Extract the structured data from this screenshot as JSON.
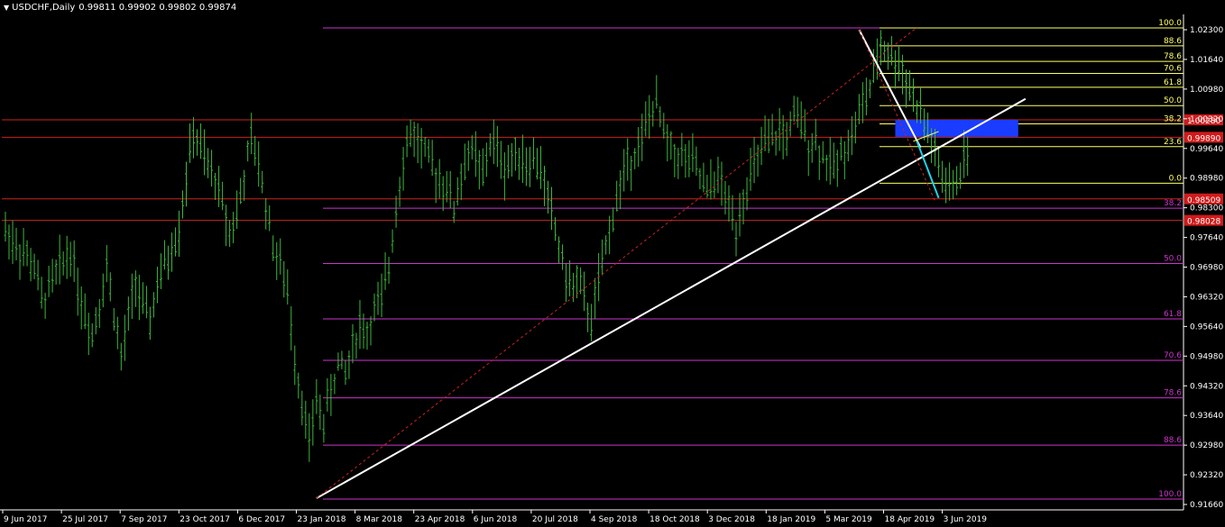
{
  "header": {
    "symbol": "USDCHF,Daily",
    "prices": "0.99811 0.99902 0.99802 0.99874"
  },
  "colors": {
    "background": "#000000",
    "candles": "#3cb83c",
    "fib_high": "#ffff66",
    "fib_low": "#cc33cc",
    "hline": "#cc2222",
    "trendline": "#ffffff",
    "dashed": "#cc2222",
    "projection": "#22d3e8",
    "zone": "#1a3cff",
    "price_tag": "#d11a1a",
    "axis_text": "#ffffff"
  },
  "chart_data": {
    "type": "candlestick",
    "title": "USDCHF,Daily",
    "ohlc_last": {
      "open": 0.99811,
      "high": 0.99902,
      "low": 0.99802,
      "close": 0.99874
    },
    "ylim": [
      0.914,
      1.0265
    ],
    "y_ticks": [
      "1.02300",
      "1.01640",
      "1.00980",
      "1.00320",
      "0.99640",
      "0.98980",
      "0.98300",
      "0.97640",
      "0.96980",
      "0.96320",
      "0.95640",
      "0.94980",
      "0.94320",
      "0.93640",
      "0.92980",
      "0.92320",
      "0.91660"
    ],
    "x_ticks": [
      "9 Jun 2017",
      "25 Jul 2017",
      "7 Sep 2017",
      "23 Oct 2017",
      "6 Dec 2017",
      "23 Jan 2018",
      "8 Mar 2018",
      "23 Apr 2018",
      "6 Jun 2018",
      "20 Jul 2018",
      "4 Sep 2018",
      "18 Oct 2018",
      "3 Dec 2018",
      "18 Jan 2019",
      "5 Mar 2019",
      "18 Apr 2019",
      "3 Jun 2019"
    ],
    "price_path": [
      [
        0,
        0.978
      ],
      [
        4,
        0.974
      ],
      [
        8,
        0.97
      ],
      [
        10,
        0.962
      ],
      [
        14,
        0.968
      ],
      [
        18,
        0.974
      ],
      [
        21,
        0.962
      ],
      [
        24,
        0.955
      ],
      [
        26,
        0.962
      ],
      [
        28,
        0.97
      ],
      [
        30,
        0.96
      ],
      [
        32,
        0.949
      ],
      [
        34,
        0.958
      ],
      [
        36,
        0.967
      ],
      [
        38,
        0.96
      ],
      [
        40,
        0.958
      ],
      [
        42,
        0.966
      ],
      [
        45,
        0.972
      ],
      [
        48,
        0.979
      ],
      [
        50,
        0.99
      ],
      [
        52,
        1.0
      ],
      [
        54,
        0.996
      ],
      [
        56,
        0.992
      ],
      [
        58,
        0.99
      ],
      [
        60,
        0.984
      ],
      [
        62,
        0.978
      ],
      [
        64,
        0.982
      ],
      [
        66,
        0.99
      ],
      [
        68,
        0.998
      ],
      [
        70,
        0.993
      ],
      [
        72,
        0.984
      ],
      [
        74,
        0.975
      ],
      [
        76,
        0.97
      ],
      [
        78,
        0.964
      ],
      [
        80,
        0.95
      ],
      [
        82,
        0.94
      ],
      [
        84,
        0.93
      ],
      [
        86,
        0.94
      ],
      [
        88,
        0.935
      ],
      [
        90,
        0.942
      ],
      [
        92,
        0.948
      ],
      [
        94,
        0.946
      ],
      [
        96,
        0.952
      ],
      [
        98,
        0.957
      ],
      [
        100,
        0.955
      ],
      [
        102,
        0.96
      ],
      [
        104,
        0.962
      ],
      [
        106,
        0.97
      ],
      [
        108,
        0.984
      ],
      [
        110,
        0.994
      ],
      [
        112,
        1.0
      ],
      [
        114,
        0.998
      ],
      [
        116,
        0.995
      ],
      [
        118,
        0.992
      ],
      [
        120,
        0.99
      ],
      [
        122,
        0.988
      ],
      [
        124,
        0.983
      ],
      [
        126,
        0.99
      ],
      [
        128,
        0.996
      ],
      [
        130,
        0.994
      ],
      [
        132,
        0.99
      ],
      [
        134,
        0.998
      ],
      [
        136,
        0.996
      ],
      [
        138,
        0.992
      ],
      [
        140,
        0.994
      ],
      [
        142,
        0.996
      ],
      [
        144,
        0.993
      ],
      [
        146,
        0.994
      ],
      [
        148,
        0.992
      ],
      [
        150,
        0.985
      ],
      [
        152,
        0.978
      ],
      [
        154,
        0.971
      ],
      [
        156,
        0.965
      ],
      [
        158,
        0.967
      ],
      [
        160,
        0.962
      ],
      [
        162,
        0.958
      ],
      [
        164,
        0.966
      ],
      [
        166,
        0.974
      ],
      [
        168,
        0.982
      ],
      [
        170,
        0.988
      ],
      [
        172,
        0.993
      ],
      [
        174,
        0.996
      ],
      [
        176,
        0.998
      ],
      [
        178,
        1.004
      ],
      [
        180,
        1.006
      ],
      [
        182,
        1.0
      ],
      [
        184,
        0.996
      ],
      [
        186,
        0.995
      ],
      [
        188,
        0.994
      ],
      [
        190,
        0.993
      ],
      [
        192,
        0.99
      ],
      [
        194,
        0.986
      ],
      [
        196,
        0.99
      ],
      [
        198,
        0.988
      ],
      [
        200,
        0.983
      ],
      [
        202,
        0.979
      ],
      [
        204,
        0.986
      ],
      [
        206,
        0.99
      ],
      [
        208,
        0.994
      ],
      [
        210,
        0.997
      ],
      [
        212,
        0.998
      ],
      [
        214,
        1.0
      ],
      [
        216,
        0.999
      ],
      [
        218,
        1.003
      ],
      [
        220,
        1.002
      ],
      [
        222,
        0.998
      ],
      [
        224,
        0.998
      ],
      [
        226,
        0.995
      ],
      [
        228,
        0.992
      ],
      [
        230,
        0.993
      ],
      [
        232,
        0.997
      ],
      [
        234,
        0.999
      ],
      [
        236,
        1.004
      ],
      [
        238,
        1.008
      ],
      [
        240,
        1.012
      ],
      [
        242,
        1.02
      ],
      [
        244,
        1.018
      ],
      [
        246,
        1.016
      ],
      [
        248,
        1.014
      ],
      [
        250,
        1.01
      ],
      [
        252,
        1.006
      ],
      [
        254,
        1.002
      ],
      [
        256,
        0.998
      ],
      [
        258,
        0.992
      ],
      [
        260,
        0.988
      ],
      [
        262,
        0.987
      ],
      [
        264,
        0.992
      ],
      [
        266,
        0.996
      ]
    ],
    "fib_upper": {
      "swing_low": 0.9886,
      "swing_high": 1.0234,
      "levels": [
        {
          "label": "100.0",
          "value": 1.0234
        },
        {
          "label": "88.6",
          "value": 1.0194
        },
        {
          "label": "78.6",
          "value": 1.0159
        },
        {
          "label": "70.6",
          "value": 1.0132
        },
        {
          "label": "61.8",
          "value": 1.0101
        },
        {
          "label": "50.0",
          "value": 1.006
        },
        {
          "label": "38.2",
          "value": 1.0019
        },
        {
          "label": "23.6",
          "value": 0.9968
        },
        {
          "label": "0.0",
          "value": 0.9886
        }
      ]
    },
    "fib_lower": {
      "swing_low": 0.9178,
      "swing_high": 1.0234,
      "levels": [
        {
          "label": "38.2",
          "value": 0.983
        },
        {
          "label": "50.0",
          "value": 0.9706
        },
        {
          "label": "61.8",
          "value": 0.9582
        },
        {
          "label": "70.6",
          "value": 0.9489
        },
        {
          "label": "78.6",
          "value": 0.9405
        },
        {
          "label": "88.6",
          "value": 0.9299
        },
        {
          "label": "100.0",
          "value": 0.9178
        }
      ]
    },
    "horizontal_lines": [
      {
        "tag": "1.00280",
        "value": 1.0028
      },
      {
        "tag": "0.99890",
        "value": 0.9989
      },
      {
        "tag": "0.98509",
        "value": 0.98509
      },
      {
        "tag": "0.98028",
        "value": 0.98028
      }
    ],
    "zone": {
      "from_day": 246,
      "to_day": 280,
      "low": 0.999,
      "high": 1.0028
    },
    "trendlines": [
      {
        "from": [
          86,
          0.918
        ],
        "to": [
          282,
          1.0075
        ],
        "style": "solid",
        "color": "#ffffff"
      },
      {
        "from": [
          86,
          0.918
        ],
        "to": [
          252,
          1.0235
        ],
        "style": "dashed",
        "color": "#cc2222"
      },
      {
        "from": [
          236,
          1.023
        ],
        "to": [
          253,
          0.9966
        ],
        "style": "solid",
        "color": "#ffffff"
      },
      {
        "from": [
          236,
          1.023
        ],
        "to": [
          257,
          0.9846
        ],
        "style": "dashed",
        "color": "#cc2222"
      },
      {
        "from": [
          251,
          0.998
        ],
        "to": [
          258,
          1.0002
        ],
        "style": "solid",
        "color": "#ffff66"
      },
      {
        "from": [
          252,
          0.998
        ],
        "to": [
          258,
          0.9853
        ],
        "style": "solid",
        "color": "#22d3e8"
      }
    ]
  }
}
